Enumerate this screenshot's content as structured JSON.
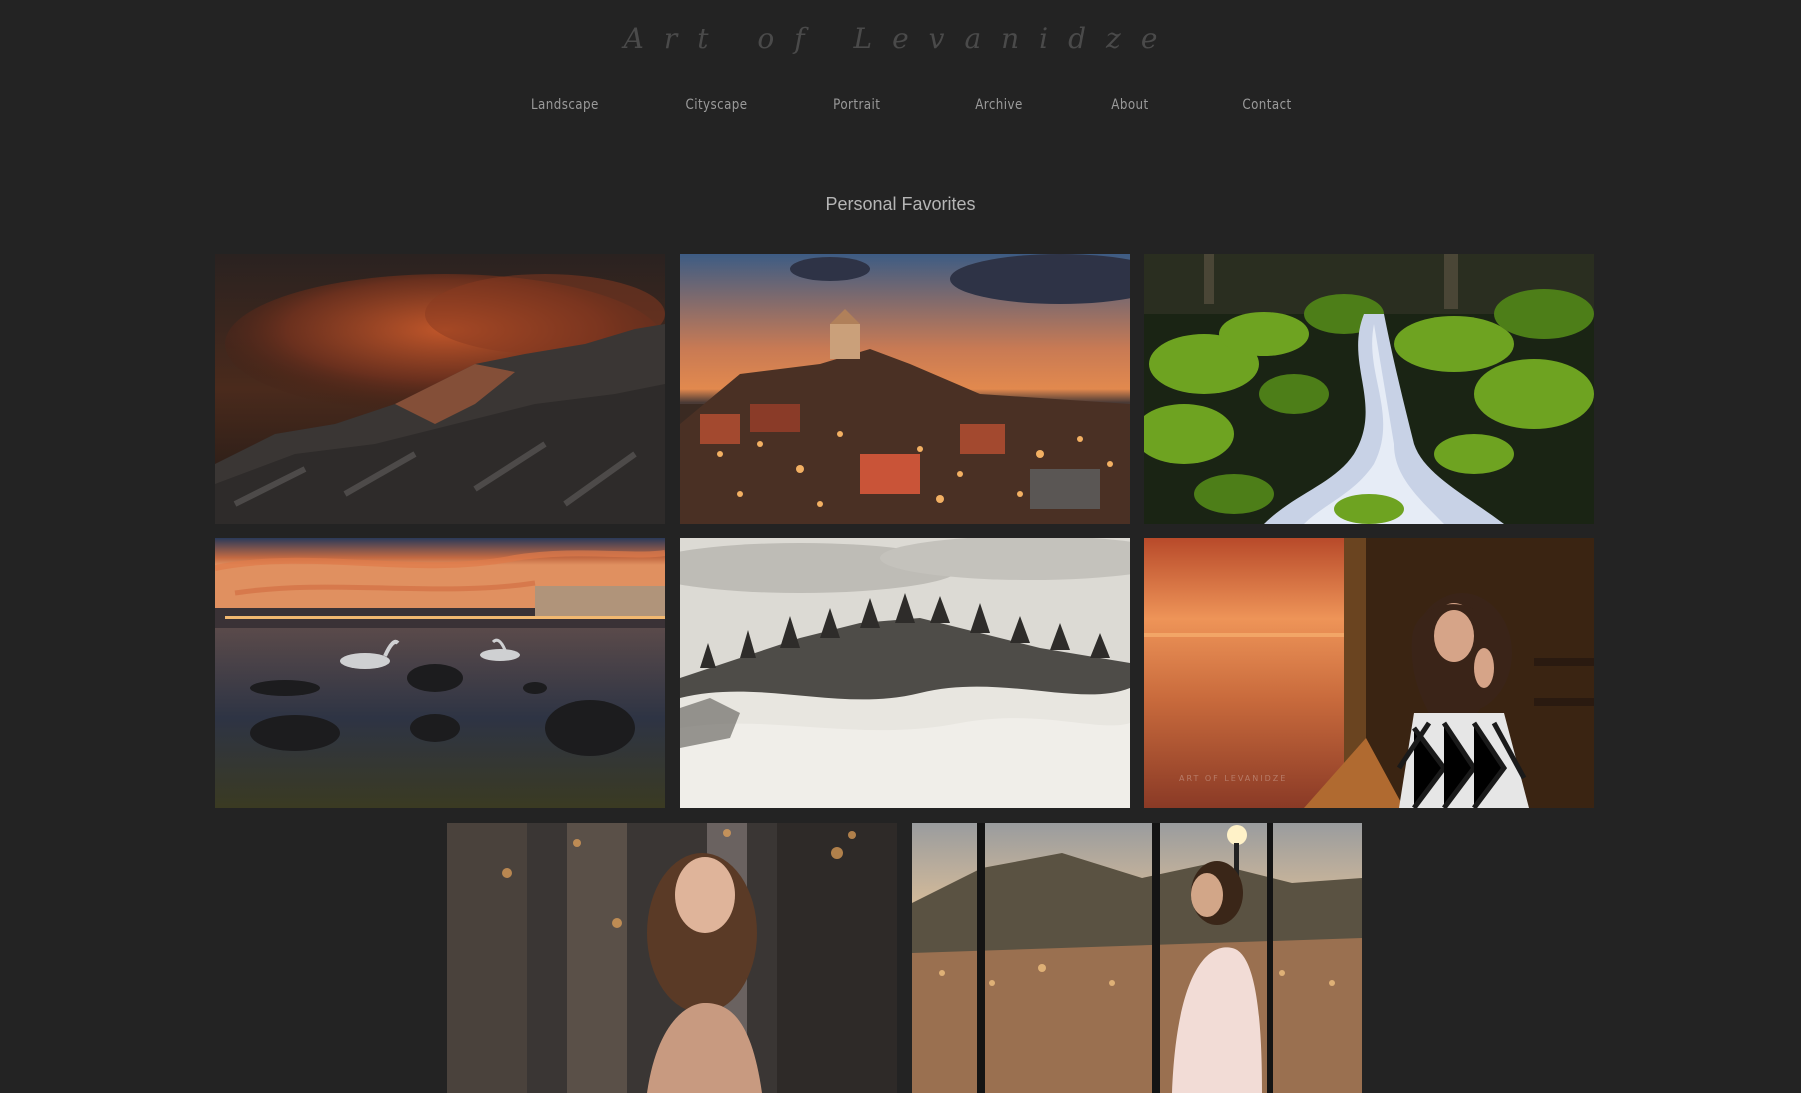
{
  "site": {
    "title": "Art of Levanidze"
  },
  "nav": {
    "items": [
      {
        "label": "Landscape"
      },
      {
        "label": "Cityscape"
      },
      {
        "label": "Portrait"
      },
      {
        "label": "Archive"
      },
      {
        "label": "About"
      },
      {
        "label": "Contact"
      }
    ]
  },
  "gallery": {
    "heading": "Personal Favorites",
    "tiles": [
      {
        "subject": "mountain-sunset"
      },
      {
        "subject": "city-night-view"
      },
      {
        "subject": "mossy-waterfall"
      },
      {
        "subject": "lake-swans-sunset"
      },
      {
        "subject": "foggy-forest-hills"
      },
      {
        "subject": "woman-at-window-sunset",
        "watermark": "ART OF LEVANIDZE"
      },
      {
        "subject": "woman-street-portrait"
      },
      {
        "subject": "woman-city-view-window"
      }
    ]
  },
  "colors": {
    "background": "#232323",
    "title": "#4a4a4a",
    "nav": "#9a9a9a",
    "heading": "#b5b5b5"
  }
}
